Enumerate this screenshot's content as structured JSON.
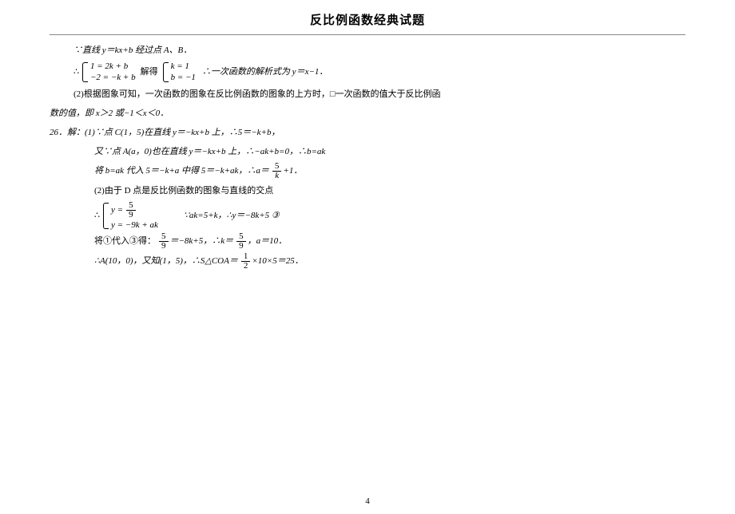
{
  "header": {
    "title": "反比例函数经典试题"
  },
  "body": {
    "p1": "∵直线 y＝kx+b 经过点 A、B．",
    "eq1_prefix": "∴",
    "eq1_sys_a": "1 = 2k + b",
    "eq1_sys_b": "−2 = −k + b",
    "eq1_mid": "解得",
    "eq1_sol_a": "k = 1",
    "eq1_sol_b": "b = −1",
    "eq1_suffix": "∴一次函数的解析式为 y＝x−1．",
    "p2": "(2)根据图象可知，一次函数的图象在反比例函数的图象的上方时，□一次函数的值大于反比例函",
    "p2b": "数的值，即 x＞2 或−1＜x＜0．",
    "p3": "26．解：(1)∵点 C(1，5)在直线 y＝−kx+b 上，∴5＝−k+b，",
    "p4": "又∵点 A(a，0)也在直线 y＝−kx+b 上，∴−ak+b=0，∴b=ak",
    "p5_a": "将 b=ak 代入 5＝−k+a 中得 5＝−k+ak，∴a＝",
    "p5_frac_num": "5",
    "p5_frac_den": "k",
    "p5_b": "+1．",
    "p6": "(2)由于 D 点是反比例函数的图象与直线的交点",
    "eq2_prefix": "∴",
    "eq2_a_left": "y =",
    "eq2_a_num": "5",
    "eq2_a_den": "9",
    "eq2_b": "y = −9k + ak",
    "eq2_mid": "∵ak=5+k，∴y＝−8k+5   ③",
    "p7_a": "将①代入③得：",
    "p7_f1_num": "5",
    "p7_f1_den": "9",
    "p7_b": "＝−8k+5，∴k＝",
    "p7_f2_num": "5",
    "p7_f2_den": "9",
    "p7_c": "，a＝10．",
    "p8_a": "∴A(10，0)，又知(1，5)，∴S△COA＝",
    "p8_f_num": "1",
    "p8_f_den": "2",
    "p8_b": "×10×5＝25．"
  },
  "footer": {
    "page": "4"
  }
}
